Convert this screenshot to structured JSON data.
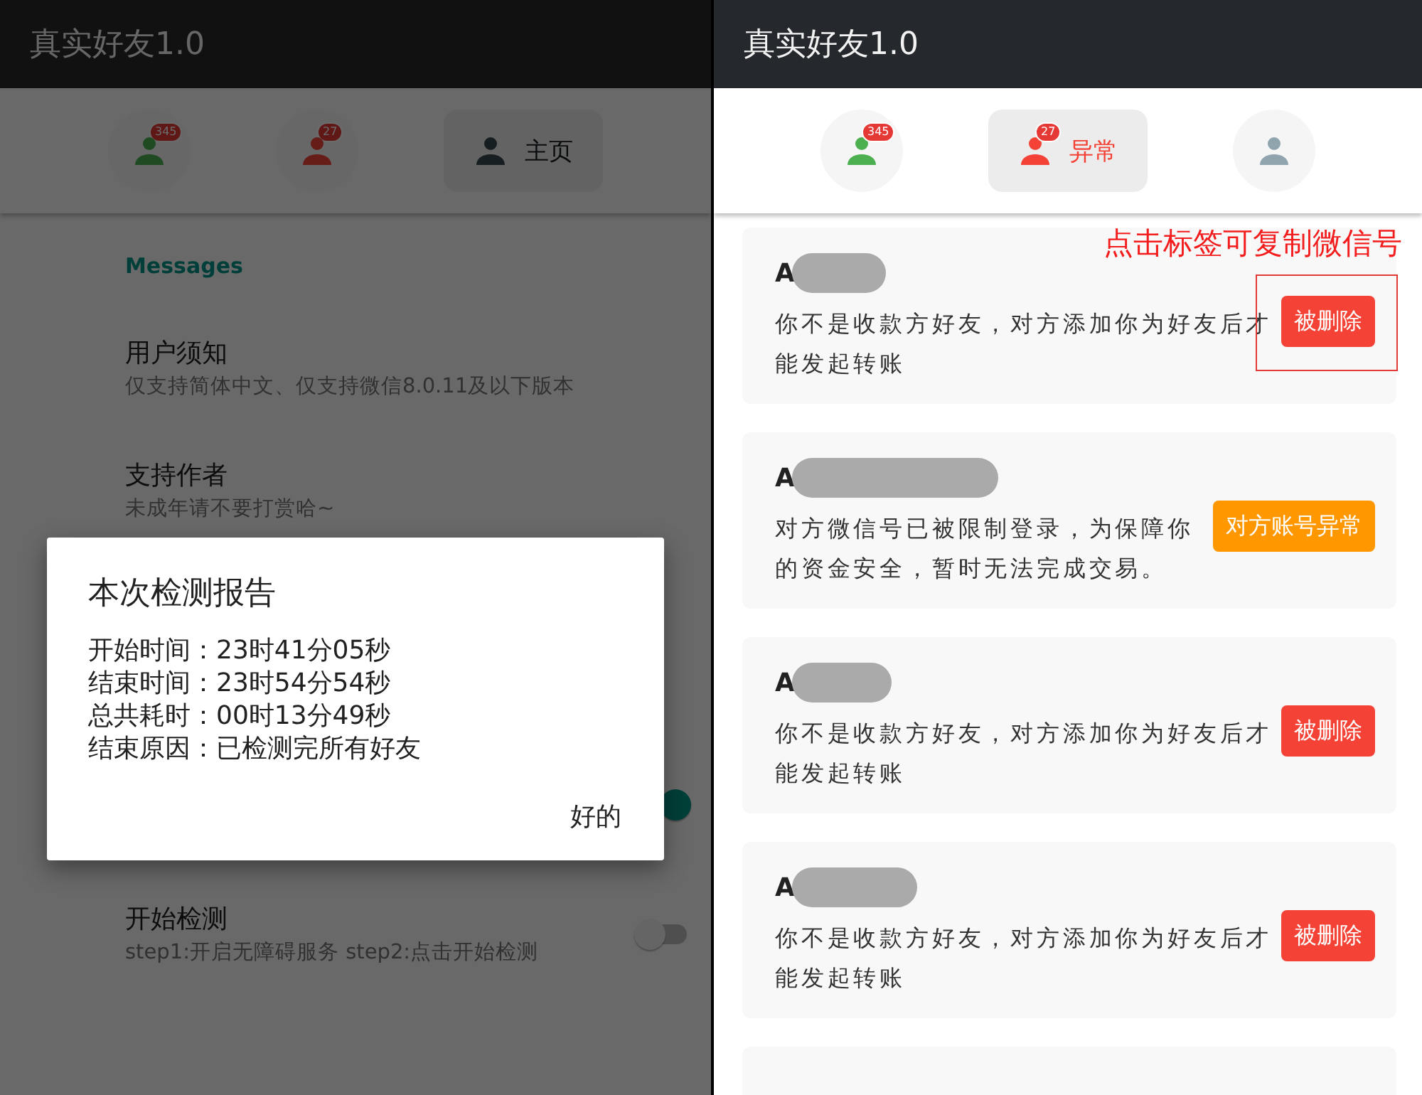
{
  "left_screen": {
    "app_bar": {
      "title": "真实好友1.0"
    },
    "tabs": [
      {
        "badge": "345",
        "color": "#204a22",
        "selected": false
      },
      {
        "badge": "27",
        "color": "#661c17",
        "selected": false
      },
      {
        "label": "主页",
        "color": "#171e21",
        "selected": true
      }
    ],
    "section": "Messages",
    "items": [
      {
        "kind": "text",
        "title": "用户须知",
        "subtitle": "仅支持简体中文、仅支持微信8.0.11及以下版本"
      },
      {
        "kind": "text",
        "title": "支持作者",
        "subtitle": "未成年请不要打赏哈~"
      },
      {
        "kind": "switch",
        "on": true
      },
      {
        "kind": "switch",
        "title": "开始检测",
        "subtitle": "step1:开启无障碍服务 step2:点击开始检测",
        "on": false
      }
    ],
    "dialog": {
      "title": "本次检测报告",
      "lines": [
        "开始时间：23时41分05秒",
        "结束时间：23时54分54秒",
        "总共耗时：00时13分49秒",
        "结束原因：已检测完所有好友"
      ],
      "button": "好的"
    }
  },
  "right_screen": {
    "app_bar": {
      "title": "真实好友1.0"
    },
    "tabs": [
      {
        "badge": "345",
        "color": "#4caf50",
        "selected": false
      },
      {
        "badge": "27",
        "label": "异常",
        "color": "#f44336",
        "selected": true
      },
      {
        "color": "#90a4ae",
        "selected": false
      }
    ],
    "annotation": "点击标签可复制微信号",
    "cards": [
      {
        "name": "A",
        "message": "你不是收款方好友，对方添加你为好友后才能发起转账",
        "tag": "被删除",
        "color": "#f44336",
        "highlighted": true
      },
      {
        "name": "A",
        "message": "对方微信号已被限制登录，为保障你的资金安全，暂时无法完成交易。",
        "tag": "对方账号异常",
        "color": "#ff9800",
        "highlighted": false
      },
      {
        "name": "A",
        "message": "你不是收款方好友，对方添加你为好友后才能发起转账",
        "tag": "被删除",
        "color": "#f44336",
        "highlighted": false
      },
      {
        "name": "A",
        "message": "你不是收款方好友，对方添加你为好友后才能发起转账",
        "tag": "被删除",
        "color": "#f44336",
        "highlighted": false
      }
    ]
  }
}
